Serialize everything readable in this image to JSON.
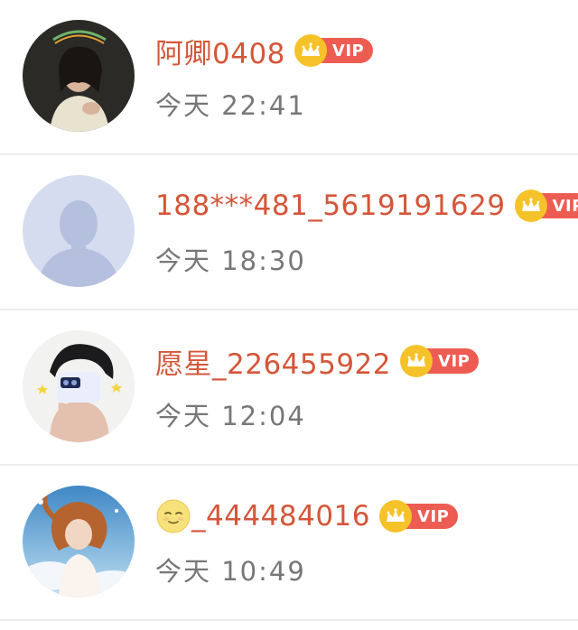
{
  "colors": {
    "name": "#d4563a",
    "time": "#777777",
    "vip_pill": "#ed5c52",
    "vip_crown": "#f6c229",
    "divider": "#ededed"
  },
  "rows": [
    {
      "name": "阿卿0408",
      "badge": "VIP",
      "time": "今天 22:41",
      "avatar": "woman-photo-avatar"
    },
    {
      "name": "188***481_5619191629",
      "badge": "VIP",
      "time": "今天 18:30",
      "avatar": "default-person-avatar"
    },
    {
      "name": "愿星_226455922",
      "badge": "VIP",
      "time": "今天 12:04",
      "avatar": "phone-selfie-avatar"
    },
    {
      "name_emoji": "smiling-moon-face-icon",
      "name": "_444484016",
      "badge": "VIP",
      "time": "今天 10:49",
      "avatar": "anime-girl-avatar"
    }
  ]
}
